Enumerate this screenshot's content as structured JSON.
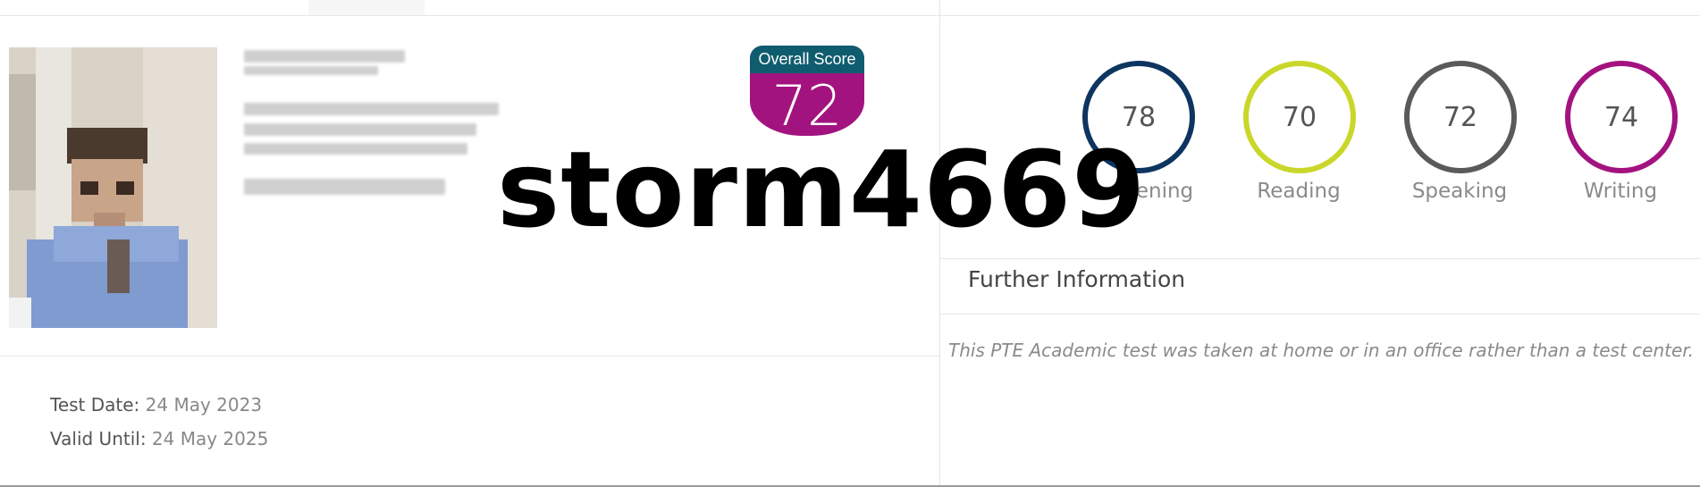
{
  "score": {
    "overall_label": "Overall Score",
    "overall_value": "72",
    "badge_colors": {
      "top": "#0f5c6e",
      "body": "#a3137f"
    }
  },
  "skills": [
    {
      "label": "Listening",
      "visible_label": "ening",
      "value": "78",
      "color": "#0d3560"
    },
    {
      "label": "Reading",
      "visible_label": "Reading",
      "value": "70",
      "color": "#c9d72a"
    },
    {
      "label": "Speaking",
      "visible_label": "Speaking",
      "value": "72",
      "color": "#5a5a5a"
    },
    {
      "label": "Writing",
      "visible_label": "Writing",
      "value": "74",
      "color": "#a3137f"
    }
  ],
  "further_info": {
    "title": "Further Information",
    "note": "This PTE Academic test was taken at home or in an office rather than a test center."
  },
  "dates": {
    "test_date_label": "Test Date:",
    "test_date_value": " 24 May 2023",
    "valid_until_label": "Valid Until:",
    "valid_until_value": " 24 May 2025"
  },
  "watermark": "storm4669"
}
